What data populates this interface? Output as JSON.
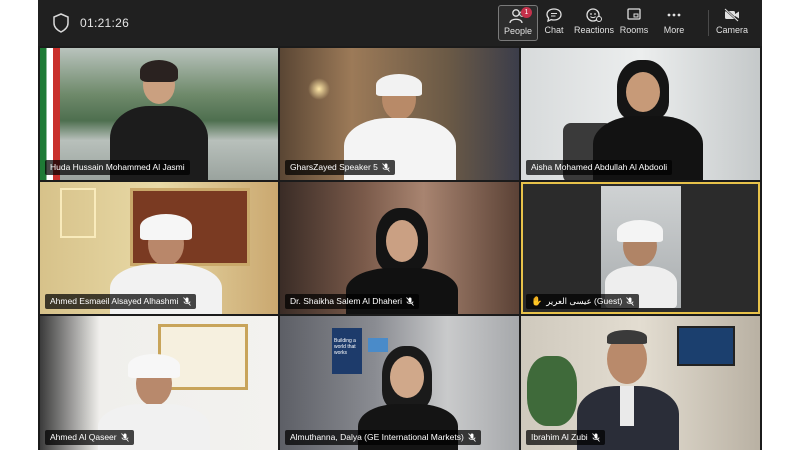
{
  "meeting": {
    "timer": "01:21:26"
  },
  "toolbar": {
    "people": {
      "label": "People",
      "badge": "1",
      "icon": "people-icon"
    },
    "chat": {
      "label": "Chat",
      "icon": "chat-icon"
    },
    "reactions": {
      "label": "Reactions",
      "icon": "reactions-icon"
    },
    "rooms": {
      "label": "Rooms",
      "icon": "rooms-icon"
    },
    "more": {
      "label": "More",
      "icon": "more-icon"
    },
    "camera": {
      "label": "Camera",
      "icon": "camera-off-icon"
    }
  },
  "participants": [
    {
      "name": "Huda Hussain Mohammed Al Jasmi",
      "muted": false
    },
    {
      "name": "GharsZayed Speaker 5",
      "muted": true
    },
    {
      "name": "Aisha Mohamed Abdullah Al Abdooli",
      "muted": false
    },
    {
      "name": "Ahmed Esmaeil Alsayed Alhashmi",
      "muted": true
    },
    {
      "name": "Dr. Shaikha Salem Al Dhaheri",
      "muted": true
    },
    {
      "name": "عيسى العرير (Guest)",
      "muted": true,
      "hand_raised": true,
      "speaking": true
    },
    {
      "name": "Ahmed Al Qaseer",
      "muted": true
    },
    {
      "name": "Almuthanna, Dalya (GE International Markets)",
      "muted": true
    },
    {
      "name": "Ibrahim Al Zubi",
      "muted": true
    }
  ],
  "background_text": {
    "poster": "Building a world that works"
  },
  "colors": {
    "toolbar_bg": "#202020",
    "speaking_outline": "#e8c24a",
    "badge": "#c4314b"
  }
}
